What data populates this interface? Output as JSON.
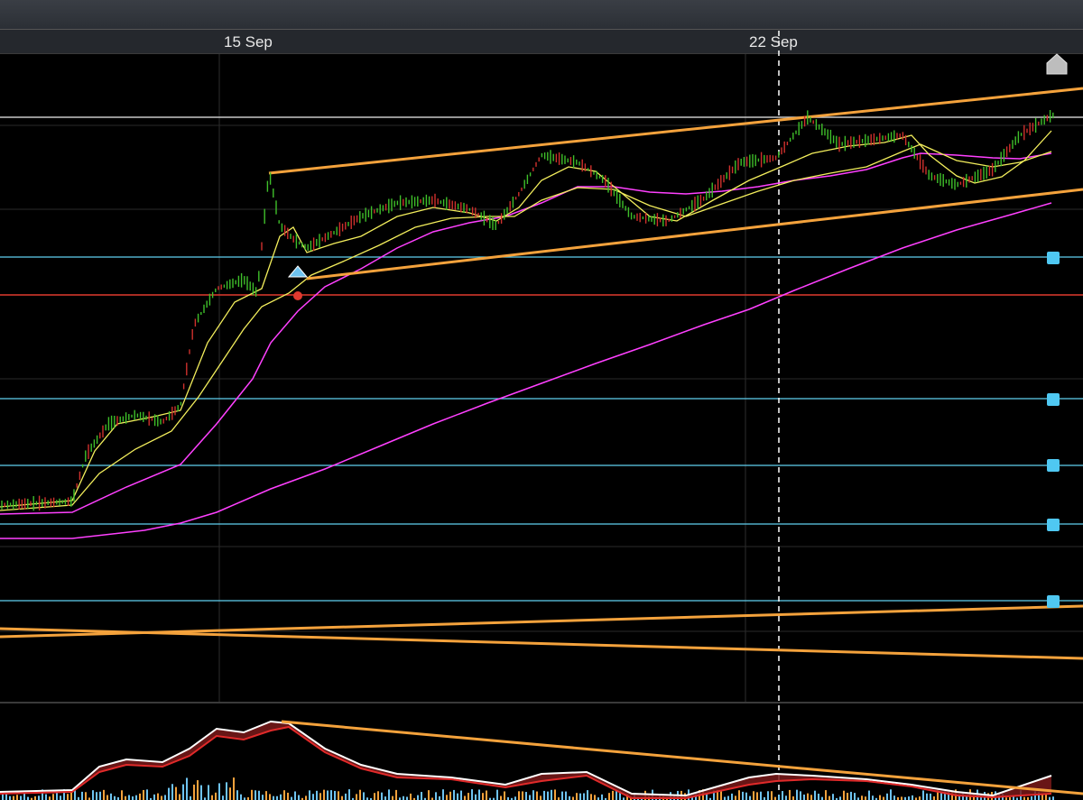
{
  "toolbar": {},
  "time_axis": {
    "labels": [
      "15 Sep",
      "22 Sep"
    ]
  },
  "chart_data": {
    "type": "line",
    "chart_kind": "candlestick",
    "x_axis": "date",
    "grid": true,
    "colors": {
      "background": "#000000",
      "candle_up": "#3fbf2a",
      "candle_down": "#d0312d",
      "ma_fast": "#f3ee5c",
      "ma_slow": "#ff40ff",
      "trendline": "#f4a23c",
      "horizontal_level": "#5fd0f0",
      "stop_level": "#e03a2f",
      "reference_level": "#c8c8c8",
      "crosshair": "#ffffff"
    },
    "trend_channel": {
      "upper": "rising",
      "lower": "rising"
    },
    "horizontal_levels": 5,
    "oscillator": {
      "panel": "bottom",
      "lines": [
        "white",
        "red"
      ],
      "histogram_colors": [
        "#6ec3f0",
        "#f4a23c"
      ]
    }
  },
  "icons": {
    "home": "home-icon",
    "buy_marker": "triangle-up-icon",
    "sell_marker": "dot-icon"
  }
}
